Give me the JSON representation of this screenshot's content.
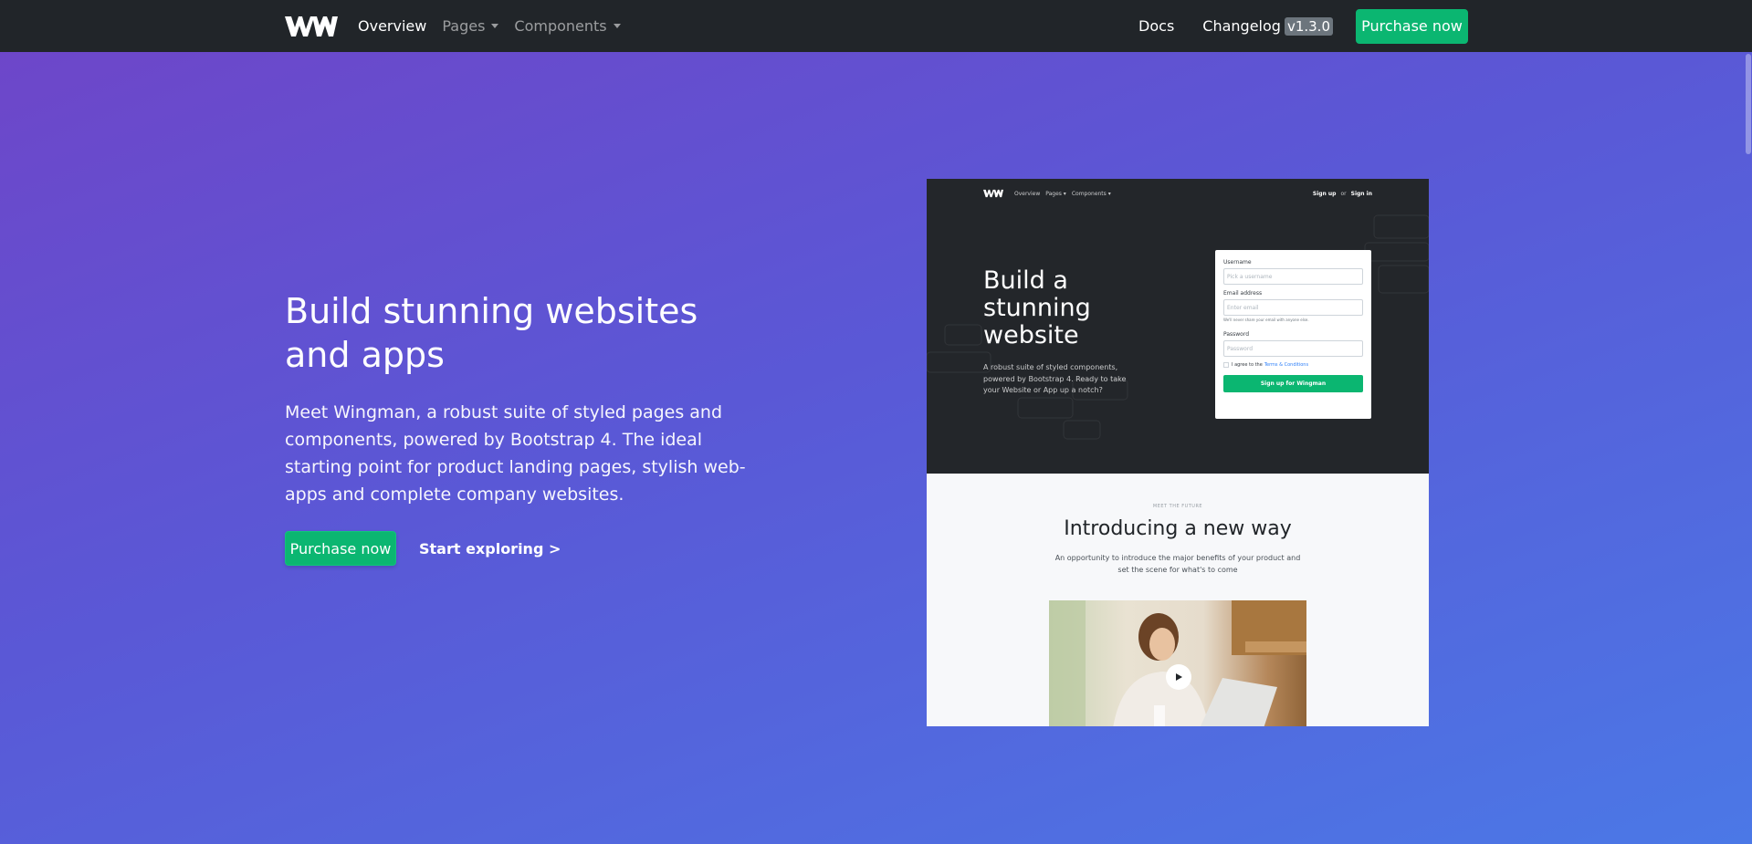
{
  "navbar": {
    "logo_icon": "wingman-logo-icon",
    "links": [
      {
        "label": "Overview",
        "active": true
      },
      {
        "label": "Pages",
        "dropdown": true
      },
      {
        "label": "Components",
        "dropdown": true
      }
    ],
    "docs_label": "Docs",
    "changelog_label": "Changelog",
    "version_badge": "v1.3.0",
    "purchase_label": "Purchase now"
  },
  "hero": {
    "title": "Build stunning websites and apps",
    "lead": "Meet Wingman, a robust suite of styled pages and components, powered by Bootstrap 4. The ideal starting point for product landing pages, stylish web-apps and complete company websites.",
    "purchase_label": "Purchase now",
    "explore_label": "Start exploring >"
  },
  "preview": {
    "nav": {
      "links": [
        "Overview",
        "Pages ▾",
        "Components ▾"
      ],
      "sign_up": "Sign up",
      "or": "or",
      "sign_in": "Sign in"
    },
    "title": "Build a stunning website",
    "lead": "A robust suite of styled components, powered by Bootstrap 4. Ready to take your Website or App up a notch?",
    "form": {
      "username_label": "Username",
      "username_placeholder": "Pick a username",
      "email_label": "Email address",
      "email_placeholder": "Enter email",
      "email_help": "We'll never share your email with anyone else.",
      "password_label": "Password",
      "password_placeholder": "Password",
      "agree_text": "I agree to the",
      "terms_link": "Terms & Conditions",
      "submit_label": "Sign up for Wingman"
    },
    "kicker": "MEET THE FUTURE",
    "heading": "Introducing a new way",
    "sub": "An opportunity to introduce the major benefits of your product and set the scene for what's to come",
    "play_icon": "play-icon"
  },
  "colors": {
    "navbar_bg": "#212529",
    "accent_green": "#0bb671",
    "gradient_start": "#6f45c8",
    "gradient_end": "#4b78e6",
    "badge_bg": "#6c757d"
  }
}
